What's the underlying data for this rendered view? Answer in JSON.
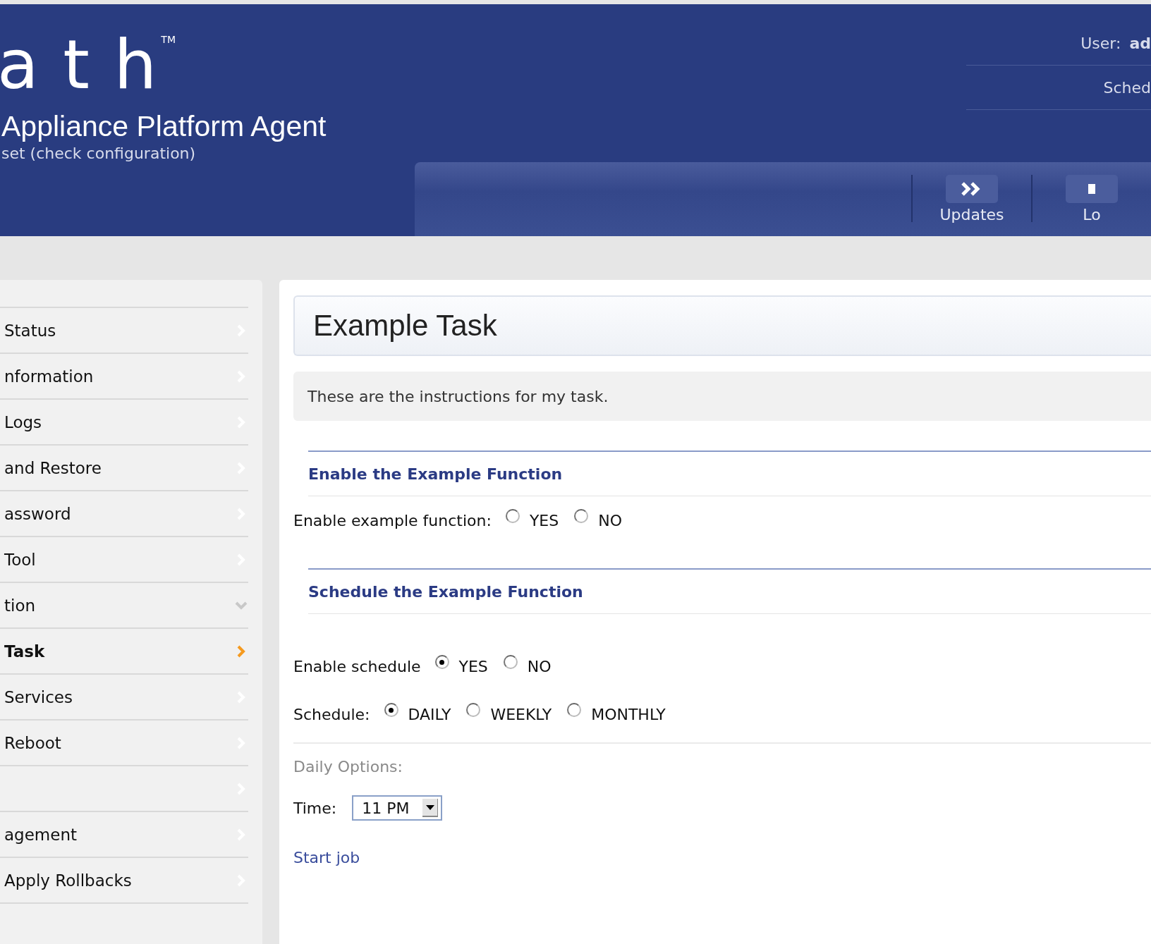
{
  "header": {
    "logo": "a t h",
    "trademark": "TM",
    "product": "Appliance Platform Agent",
    "notice": "set (check configuration)",
    "user_label": "User:",
    "user_value": "ad",
    "schedule_label": "Sched",
    "nav": [
      {
        "label": "Updates",
        "kind": "updates"
      },
      {
        "label": "Lo",
        "kind": "other"
      }
    ]
  },
  "sidebar": {
    "items": [
      {
        "label": "Status",
        "selected": false,
        "expanded": false
      },
      {
        "label": "nformation",
        "selected": false,
        "expanded": false
      },
      {
        "label": "Logs",
        "selected": false,
        "expanded": false
      },
      {
        "label": "and Restore",
        "selected": false,
        "expanded": false
      },
      {
        "label": "assword",
        "selected": false,
        "expanded": false
      },
      {
        "label": "Tool",
        "selected": false,
        "expanded": false
      },
      {
        "label": "tion",
        "selected": false,
        "expanded": true
      },
      {
        "label": "Task",
        "selected": true,
        "expanded": false
      },
      {
        "label": "Services",
        "selected": false,
        "expanded": false
      },
      {
        "label": "Reboot",
        "selected": false,
        "expanded": false
      },
      {
        "selected": false,
        "expanded": false
      },
      {
        "label": "agement",
        "selected": false,
        "expanded": false
      },
      {
        "label": "Apply Rollbacks",
        "selected": false,
        "expanded": false
      }
    ]
  },
  "main": {
    "title": "Example Task",
    "instructions": "These are the instructions for my task.",
    "sections": [
      {
        "heading": "Enable the Example Function",
        "rows": [
          {
            "label": "Enable example function:",
            "options": [
              {
                "label": "YES",
                "selected": false
              },
              {
                "label": "NO",
                "selected": false
              }
            ]
          }
        ]
      },
      {
        "heading": "Schedule the Example Function",
        "rows": [
          {
            "label": "Enable schedule",
            "options": [
              {
                "label": "YES",
                "selected": true
              },
              {
                "label": "NO",
                "selected": false
              }
            ]
          },
          {
            "label": "Schedule:",
            "options": [
              {
                "label": "DAILY",
                "selected": true
              },
              {
                "label": "WEEKLY",
                "selected": false
              },
              {
                "label": "MONTHLY",
                "selected": false
              }
            ]
          }
        ]
      }
    ],
    "options_heading": "Daily Options:",
    "time_label": "Time:",
    "time_value": "11 PM",
    "start_link": "Start job"
  }
}
